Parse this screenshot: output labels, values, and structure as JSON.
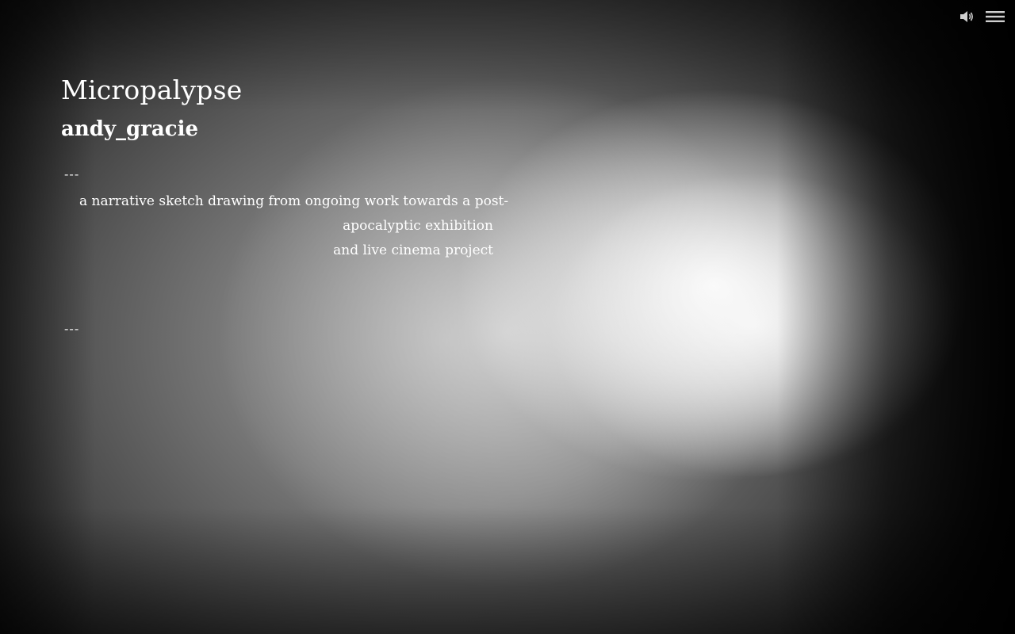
{
  "project": {
    "title": "Micropalypse",
    "author": "andy_gracie"
  },
  "content": {
    "divider_top": "---",
    "description_lines": [
      "a narrative sketch drawing from ongoing work towards a post-",
      "apocalyptic exhibition",
      "and live cinema project"
    ],
    "divider_bottom": "---"
  },
  "controls": {
    "sound_icon": "speaker-icon",
    "menu_icon": "hamburger-menu-icon"
  },
  "colors": {
    "text": "#ffffff",
    "icon": "#cfcfcf"
  }
}
